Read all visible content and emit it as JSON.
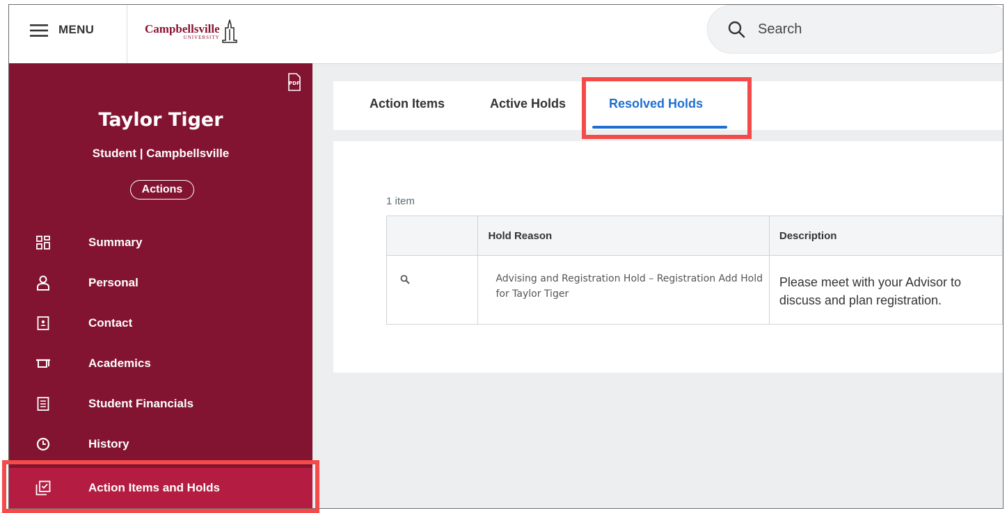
{
  "topbar": {
    "menu_label": "MENU",
    "logo_name": "Campbellsville",
    "logo_sub": "UNIVERSITY",
    "search_placeholder": "Search"
  },
  "sidebar": {
    "pdf_label": "PDF",
    "name": "Taylor Tiger",
    "subtitle": "Student | Campbellsville",
    "actions_label": "Actions",
    "items": [
      {
        "label": "Summary",
        "icon": "grid-icon"
      },
      {
        "label": "Personal",
        "icon": "person-icon"
      },
      {
        "label": "Contact",
        "icon": "contact-card-icon"
      },
      {
        "label": "Academics",
        "icon": "graduation-cap-icon"
      },
      {
        "label": "Student Financials",
        "icon": "ledger-icon"
      },
      {
        "label": "History",
        "icon": "clock-icon"
      },
      {
        "label": "Action Items and Holds",
        "icon": "checklist-icon",
        "active": true
      }
    ]
  },
  "tabs": [
    {
      "label": "Action Items"
    },
    {
      "label": "Active Holds"
    },
    {
      "label": "Resolved Holds",
      "active": true
    }
  ],
  "table": {
    "count": "1 item",
    "columns": [
      "",
      "Hold Reason",
      "Description"
    ],
    "rows": [
      {
        "hold_reason": "Advising and Registration Hold – Registration Add Hold for Taylor Tiger",
        "description": "Please meet with your Advisor to discuss and plan registration."
      }
    ]
  },
  "colors": {
    "brand": "#821431",
    "sidebar_active": "#b51c42",
    "tab_active": "#1f6fd1",
    "highlight": "#f44a4a"
  }
}
